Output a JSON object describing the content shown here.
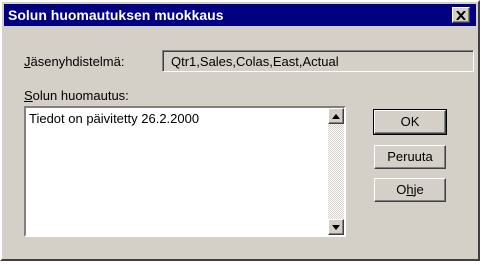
{
  "window": {
    "title": "Solun huomautuksen muokkaus",
    "close_glyph": "✕"
  },
  "member": {
    "label_mnemonic": "J",
    "label_rest": "äsenyhdistelmä:",
    "value": "Qtr1,Sales,Colas,East,Actual"
  },
  "note": {
    "label_mnemonic": "S",
    "label_rest": "olun huomautus:",
    "text": "Tiedot on päivitetty 26.2.2000"
  },
  "buttons": {
    "ok": "OK",
    "cancel": "Peruuta",
    "help_prefix": "O",
    "help_mnemonic": "h",
    "help_suffix": "je"
  },
  "icons": {
    "close": "close-icon",
    "scroll_up": "arrow-up-icon",
    "scroll_down": "arrow-down-icon"
  }
}
